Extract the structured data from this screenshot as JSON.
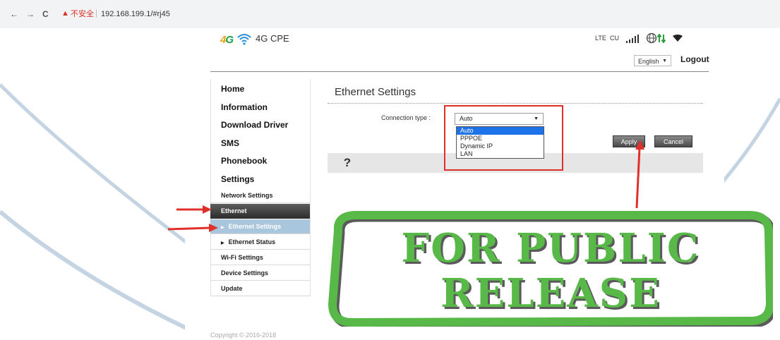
{
  "browser": {
    "back": "←",
    "forward": "→",
    "reload": "C",
    "warning": "▲",
    "insecure_label": "不安全",
    "url": "192.168.199.1/#rj45"
  },
  "header": {
    "logo_4g_a": "4",
    "logo_4g_b": "G",
    "brand": "4G CPE",
    "network_lte": "LTE",
    "network_operator": "CU",
    "language": "English",
    "logout": "Logout"
  },
  "sidebar": {
    "top_items": [
      "Home",
      "Information",
      "Download Driver",
      "SMS",
      "Phonebook",
      "Settings"
    ],
    "sub_items": {
      "network_settings": "Network Settings",
      "ethernet": "Ethernet",
      "ethernet_settings": "Ethernet Settings",
      "ethernet_status": "Ethernet Status",
      "wifi_settings": "Wi-Fi Settings",
      "device_settings": "Device Settings",
      "update": "Update"
    }
  },
  "main": {
    "title": "Ethernet Settings",
    "connection_type_label": "Connection type :",
    "connection_type_value": "Auto",
    "options": [
      "Auto",
      "PPPOE",
      "Dynamic IP",
      "LAN"
    ],
    "selected_option": "Auto",
    "apply": "Apply",
    "cancel": "Cancel",
    "help": "?"
  },
  "footer": {
    "copyright": "Copyright © 2016-2018"
  },
  "stamp": {
    "line1": "FOR PUBLIC",
    "line2": "RELEASE"
  },
  "colors": {
    "stamp_green": "#58b948",
    "annotation_red": "#e0302a",
    "selected_blue": "#1e73e8",
    "sidebar_active": "#a9c6dc"
  }
}
